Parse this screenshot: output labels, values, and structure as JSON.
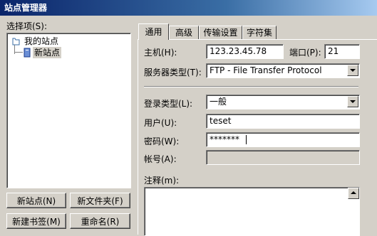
{
  "window": {
    "title": "站点管理器"
  },
  "left": {
    "select_label": "选择项(S):",
    "tree": [
      {
        "label": "我的站点",
        "icon": "folder-icon"
      },
      {
        "label": "新站点",
        "icon": "server-icon",
        "selected": true
      }
    ],
    "buttons": {
      "new_site": "新站点(N)",
      "new_folder": "新文件夹(F)",
      "new_bookmark": "新建书签(M)",
      "rename": "重命名(R)"
    }
  },
  "tabs": [
    "通用",
    "高级",
    "传输设置",
    "字符集"
  ],
  "general": {
    "host_label": "主机(H):",
    "host_value": "123.23.45.78",
    "port_label": "端口(P):",
    "port_value": "21",
    "server_type_label": "服务器类型(T):",
    "server_type_value": "FTP - File Transfer Protocol",
    "logon_type_label": "登录类型(L):",
    "logon_type_value": "一般",
    "user_label": "用户(U):",
    "user_value": "teset",
    "password_label": "密码(W):",
    "password_value": "*******",
    "account_label": "帐号(A):",
    "account_value": "",
    "comments_label": "注释(m):"
  },
  "colors": {
    "title_bar": "#0a246a",
    "tree_selection": "#d4d0c8",
    "window_bg": "#d4d0c8"
  }
}
